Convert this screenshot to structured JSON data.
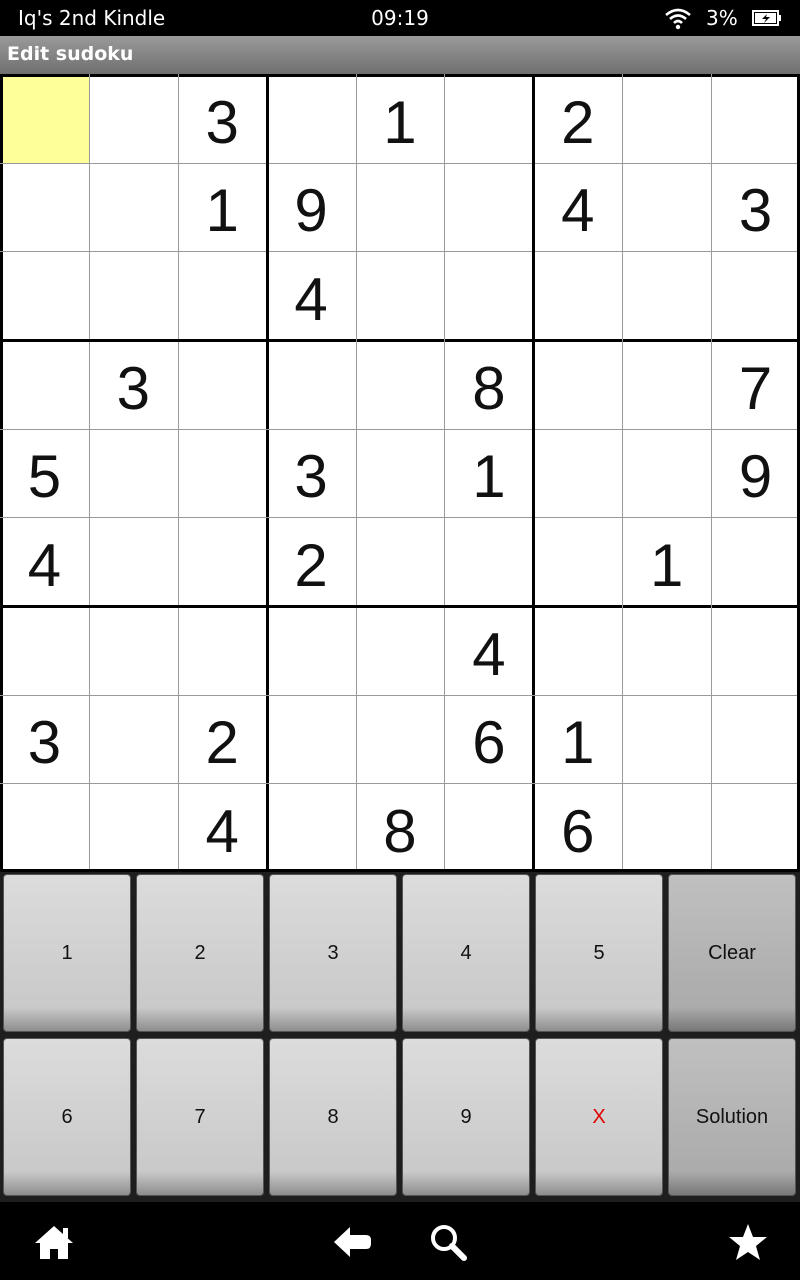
{
  "status_bar": {
    "device_name": "Iq's 2nd Kindle",
    "time": "09:19",
    "battery_percent": "3%",
    "icons": [
      "wifi-icon",
      "battery-charging-icon"
    ]
  },
  "title_bar": {
    "title": "Edit sudoku"
  },
  "board": {
    "selected_cell": {
      "row": 0,
      "col": 0
    },
    "selected_color": "#ffff99",
    "rows": [
      [
        "",
        "",
        "3",
        "",
        "1",
        "",
        "2",
        "",
        ""
      ],
      [
        "",
        "",
        "1",
        "9",
        "",
        "",
        "4",
        "",
        "3"
      ],
      [
        "",
        "",
        "",
        "4",
        "",
        "",
        "",
        "",
        ""
      ],
      [
        "",
        "3",
        "",
        "",
        "",
        "8",
        "",
        "",
        "7"
      ],
      [
        "5",
        "",
        "",
        "3",
        "",
        "1",
        "",
        "",
        "9"
      ],
      [
        "4",
        "",
        "",
        "2",
        "",
        "",
        "",
        "1",
        ""
      ],
      [
        "",
        "",
        "",
        "",
        "",
        "4",
        "",
        "",
        ""
      ],
      [
        "3",
        "",
        "2",
        "",
        "",
        "6",
        "1",
        "",
        ""
      ],
      [
        "",
        "",
        "4",
        "",
        "8",
        "",
        "6",
        "",
        ""
      ]
    ]
  },
  "keypad": {
    "keys": [
      {
        "label": "1",
        "name": "key-1"
      },
      {
        "label": "2",
        "name": "key-2"
      },
      {
        "label": "3",
        "name": "key-3"
      },
      {
        "label": "4",
        "name": "key-4"
      },
      {
        "label": "5",
        "name": "key-5"
      },
      {
        "label": "Clear",
        "name": "clear-button",
        "special": true
      },
      {
        "label": "6",
        "name": "key-6"
      },
      {
        "label": "7",
        "name": "key-7"
      },
      {
        "label": "8",
        "name": "key-8"
      },
      {
        "label": "9",
        "name": "key-9"
      },
      {
        "label": "X",
        "name": "erase-cell-button",
        "color": "#e00000"
      },
      {
        "label": "Solution",
        "name": "solution-button",
        "special": true
      }
    ]
  },
  "nav_bar": {
    "icons": [
      "home-icon",
      "back-icon",
      "search-icon",
      "favorites-star-icon"
    ]
  }
}
